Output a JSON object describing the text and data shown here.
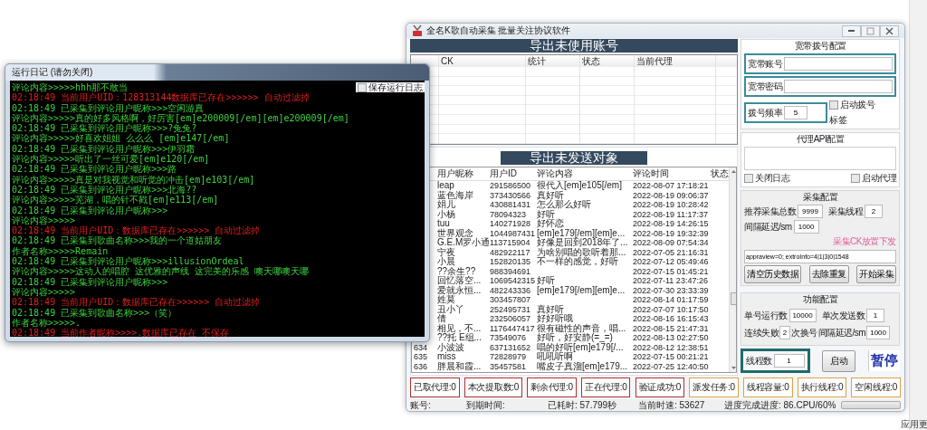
{
  "log_window": {
    "title": "运行日记 (请勿关闭)",
    "save_log": {
      "label": "保存运行日志",
      "checked": false
    },
    "lines": [
      {
        "kind": "info",
        "text": "评论内容>>>>>hhh那不敢当"
      },
      {
        "kind": "alert",
        "text": "02:18:49 当前用户UID：128313144数据库已存在>>>>>>  自动过滤掉"
      },
      {
        "kind": "info",
        "text": "02:18:49 已采集到评论用户昵称>>>空闲游真"
      },
      {
        "kind": "info",
        "text": "评论内容>>>>>真的好多风格啊，好厉害[em]e200009[/em][em]e200009[/em]"
      },
      {
        "kind": "info",
        "text": "02:18:49 已采集到评论用户昵称>>>?兔兔?"
      },
      {
        "kind": "info",
        "text": "评论内容>>>>>好喜欢姐姐 么么么 [em]e147[/em]"
      },
      {
        "kind": "info",
        "text": "02:18:49 已采集到评论用户昵称>>>伊羽霜"
      },
      {
        "kind": "info",
        "text": "评论内容>>>>>听出了一丝可爱[em]e120[/em]"
      },
      {
        "kind": "info",
        "text": "02:18:49 已采集到评论用户昵称>>>路"
      },
      {
        "kind": "info",
        "text": "评论内容>>>>>真是对我视觉和听觉的冲击[em]e103[/em]"
      },
      {
        "kind": "info",
        "text": "02:18:49 已采集到评论用户昵称>>>北海??"
      },
      {
        "kind": "info",
        "text": "评论内容>>>>>芜湖，唱的针不戳[em]e113[/em]"
      },
      {
        "kind": "info",
        "text": "02:18:49 已采集到评论用户昵称>>>"
      },
      {
        "kind": "info",
        "text": "评论内容>>>>>"
      },
      {
        "kind": "alert",
        "text": "02:18:49 当前用户UID：数据库已存在>>>>>>  自动过滤掉"
      },
      {
        "kind": "info",
        "text": "02:18:49 已采集到歌曲名称>>>我的一个道姑朋友"
      },
      {
        "kind": "info",
        "text": "作者名称>>>>>Remain"
      },
      {
        "kind": "info",
        "text": "02:18:49 已采集到评论用户昵称>>>illusionOrdeal"
      },
      {
        "kind": "info",
        "text": "评论内容>>>>>这动人的唱腔 这优雅的声线 这完美的乐感 噢天哪噢天哪"
      },
      {
        "kind": "info",
        "text": "02:18:49 已采集到评论用户昵称>>>"
      },
      {
        "kind": "info",
        "text": "评论内容>>>>>"
      },
      {
        "kind": "alert",
        "text": "02:18:49 当前用户UID：数据库已存在>>>>>>  自动过滤掉"
      },
      {
        "kind": "info",
        "text": "02:18:49 已采集到歌曲名称>>>（笑）"
      },
      {
        "kind": "info",
        "text": "作者名称>>>>>."
      },
      {
        "kind": "alert",
        "text": "02:18:49 当前作者昵称>>>>.数据库已存在 不保存"
      }
    ]
  },
  "app_window": {
    "title": "全名K歌自动采集 批量关注协议软件",
    "unused_accounts": {
      "title": "导出未使用账号",
      "columns": [
        "CK",
        "统计",
        "状态",
        "当前代理"
      ]
    },
    "targets": {
      "title": "导出未发送对象",
      "columns": [
        "用户昵称",
        "用户ID",
        "评论内容",
        "评论时间",
        "状态"
      ],
      "rows": [
        {
          "nickname": "leap",
          "uid": "291586500",
          "comment": "很代入[em]e105[/em]",
          "time": "2022-08-07 17:18:21"
        },
        {
          "nickname": "蓝色海岸",
          "uid": "373430566",
          "comment": "真好听",
          "time": "2022-08-19 09:06:37"
        },
        {
          "nickname": "娟儿",
          "uid": "430881431",
          "comment": "怎么那么好听",
          "time": "2022-08-19 10:28:42"
        },
        {
          "nickname": "小杨",
          "uid": "78094323",
          "comment": "好听",
          "time": "2022-08-19 11:17:37"
        },
        {
          "nickname": "tuu",
          "uid": "140271928",
          "comment": "好怀恋",
          "time": "2022-08-19 14:26:15"
        },
        {
          "nickname": "世界观念",
          "uid": "1044987431",
          "comment": "[em]e179[/em][em]e...",
          "time": "2022-08-19 19:32:39"
        },
        {
          "nickname": "G.E.M罗小通",
          "uid": "113715904",
          "comment": "好像是回到2018年了...",
          "time": "2022-08-09 07:54:34"
        },
        {
          "nickname": "宁夜",
          "uid": "482922117",
          "comment": "为啥别唱的歌听着那...",
          "time": "2022-07-05 21:16:31"
        },
        {
          "nickname": "小晨",
          "uid": "152820135",
          "comment": "不一样的感觉，好听",
          "time": "2022-07-12 05:49:46"
        },
        {
          "nickname": "??余生??",
          "uid": "988394691",
          "time": "2022-07-15 01:45:21"
        },
        {
          "nickname": "回忆落空...",
          "uid": "1069542315",
          "comment": "好听",
          "time": "2022-07-11 23:47:26"
        },
        {
          "nickname": "爱就永恒...",
          "uid": "482243336",
          "comment": "[em]e179[/em][em]e...",
          "time": "2022-07-30 23:33:39"
        },
        {
          "nickname": "姓莫",
          "uid": "303457807",
          "time": "2022-08-14 01:17:59"
        },
        {
          "nickname": "丑小丫",
          "uid": "252495731",
          "comment": "真好听",
          "time": "2022-07-07 10:17:50"
        },
        {
          "nickname": "倩",
          "uid": "232506057",
          "comment": "好好听哦",
          "time": "2022-08-16 16:15:43"
        },
        {
          "nickname": "相见，不...",
          "uid": "1176447417",
          "comment": "很有磁性的声音，唱...",
          "time": "2022-08-15 21:47:31"
        },
        {
          "nickname": "??托 E组...",
          "uid": "73549076",
          "comment": "好听，好安静(=_=)",
          "time": "2022-08-13 02:27:50"
        },
        {
          "number": "634",
          "nickname": "小波波",
          "uid": "637131652",
          "comment": "唱的好听[em]e179[/...",
          "time": "2022-08-12 12:38:51"
        },
        {
          "number": "635",
          "nickname": "miss",
          "uid": "72828979",
          "comment": "吼吼听啊",
          "time": "2022-07-15 00:21:21"
        },
        {
          "number": "636",
          "nickname": "胖晨和霞...",
          "uid": "35457581",
          "comment": "嘴皮子真溜[em]e179...",
          "time": "2022-07-25 12:40:50"
        }
      ]
    },
    "dial_config": {
      "title": "宽带拨号配置",
      "account": {
        "label": "宽带账号"
      },
      "password": {
        "label": "宽带密码"
      },
      "frequency": {
        "label": "拨号频率",
        "value": "5"
      },
      "auto_dial": {
        "label": "启动拨号",
        "checked": false
      },
      "tag": "标签"
    },
    "proxy_config": {
      "title": "代理API配置",
      "close_log": {
        "label": "关闭日志",
        "checked": false
      },
      "start_proxy": {
        "label": "启动代理",
        "checked": false
      }
    },
    "collect_config": {
      "title": "采集配置",
      "total": {
        "label": "推荐采集总数",
        "value": "9999"
      },
      "threads": {
        "label": "采集线程",
        "value": "2"
      },
      "delay": {
        "label": "间隔延迟/sm",
        "value": "1000"
      },
      "ck_hint": "采集CK放置下发",
      "ck_value": "appraview=0; extroInfo=4|1|3|0|1548",
      "buttons": [
        "清空历史数据",
        "去除重复",
        "开始采集"
      ]
    },
    "function_config": {
      "title": "功能配置",
      "runs": {
        "label": "单号运行数",
        "value": "10000"
      },
      "sends": {
        "label": "单次发送数",
        "value": "1"
      },
      "fail_label": "连续失败",
      "fail_value": "2",
      "fail_suffix": "次换号",
      "delay": {
        "label": "间隔延迟/sm",
        "value": "1000"
      }
    },
    "thread_count": {
      "label": "线程数",
      "value": "1"
    },
    "start_button": "启动",
    "pause_button": "暂停",
    "counters": [
      {
        "label": "已取代理:0",
        "color": "#b03030"
      },
      {
        "label": "本次提取数:0",
        "color": "#b03030"
      },
      {
        "label": "剩余代理:0",
        "color": "#b03030"
      },
      {
        "label": "正在代理:0",
        "color": "#b03030"
      },
      {
        "label": "验证成功:0",
        "color": "#b03030"
      },
      {
        "label": "派发任务:0",
        "color": "#d9a24a"
      },
      {
        "label": "线程容量:0",
        "color": "#d9a24a"
      },
      {
        "label": "执行线程:0",
        "color": "#d9a24a"
      },
      {
        "label": "空闲线程:0",
        "color": "#d9a24a"
      }
    ],
    "status_bar": {
      "account": "账号:",
      "expiry": "到期时间:",
      "elapsed": "已耗时: 57.799秒",
      "speed": "当前时速: 53627",
      "progress_label": "进度完成进度: 86.CPU/60%",
      "progress": {
        "level": 0
      }
    }
  },
  "side_panel": {
    "text": "应用更"
  }
}
